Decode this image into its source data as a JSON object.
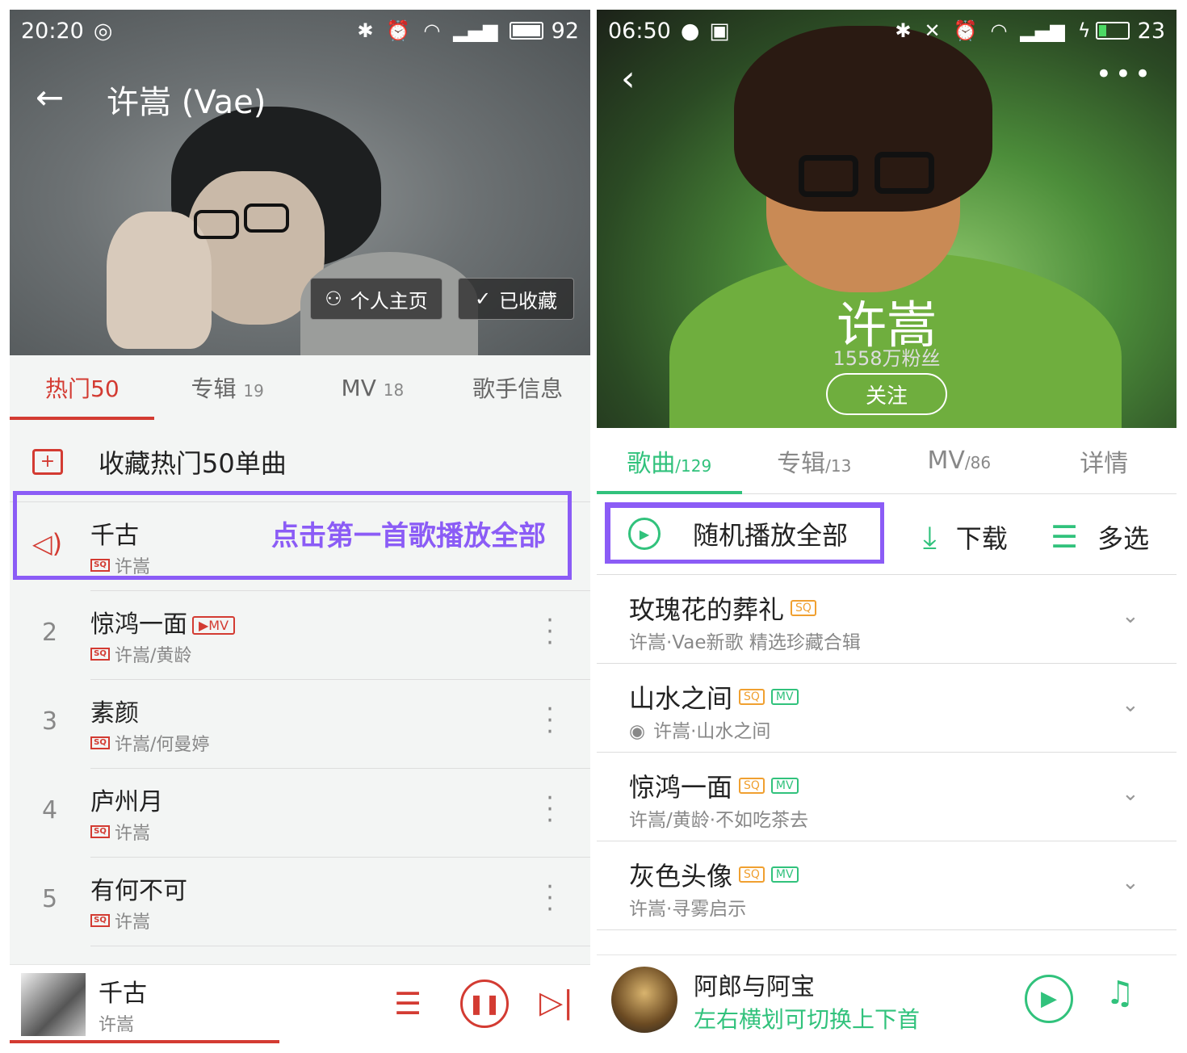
{
  "left": {
    "status": {
      "time": "20:20",
      "battery": "92"
    },
    "title": "许嵩 (Vae)",
    "buttons": {
      "profile": "个人主页",
      "collected": "已收藏"
    },
    "tabs": [
      {
        "label": "热门50",
        "count": ""
      },
      {
        "label": "专辑",
        "count": "19"
      },
      {
        "label": "MV",
        "count": "18"
      },
      {
        "label": "歌手信息",
        "count": ""
      }
    ],
    "collect_label": "收藏热门50单曲",
    "hint": "点击第一首歌播放全部",
    "songs": [
      {
        "num": "",
        "name": "千古",
        "artist": "许嵩",
        "mv": ""
      },
      {
        "num": "2",
        "name": "惊鸿一面",
        "artist": "许嵩/黄龄",
        "mv": "▶MV"
      },
      {
        "num": "3",
        "name": "素颜",
        "artist": "许嵩/何曼婷",
        "mv": ""
      },
      {
        "num": "4",
        "name": "庐州月",
        "artist": "许嵩",
        "mv": ""
      },
      {
        "num": "5",
        "name": "有何不可",
        "artist": "许嵩",
        "mv": ""
      }
    ],
    "sq_label": "SQ",
    "player": {
      "title": "千古",
      "artist": "许嵩"
    }
  },
  "right": {
    "status": {
      "time": "06:50",
      "battery": "23"
    },
    "artist": "许嵩",
    "fans": "1558万粉丝",
    "follow": "关注",
    "tabs": [
      {
        "label": "歌曲",
        "count": "/129"
      },
      {
        "label": "专辑",
        "count": "/13"
      },
      {
        "label": "MV",
        "count": "/86"
      },
      {
        "label": "详情",
        "count": ""
      }
    ],
    "actions": {
      "shuffle": "随机播放全部",
      "download": "下载",
      "multi": "多选"
    },
    "songs": [
      {
        "name": "玫瑰花的葬礼",
        "sub": "许嵩·Vae新歌 精选珍藏合辑",
        "sq": "SQ",
        "mv": ""
      },
      {
        "name": "山水之间",
        "sub": "许嵩·山水之间",
        "sq": "SQ",
        "mv": "MV"
      },
      {
        "name": "惊鸿一面",
        "sub": "许嵩/黄龄·不如吃茶去",
        "sq": "SQ",
        "mv": "MV"
      },
      {
        "name": "灰色头像",
        "sub": "许嵩·寻雾启示",
        "sq": "SQ",
        "mv": "MV"
      }
    ],
    "player": {
      "title": "阿郎与阿宝",
      "hint": "左右横划可切换上下首"
    }
  },
  "colors": {
    "netease_red": "#d33b32",
    "qq_green": "#31c27c",
    "highlight": "#8b5cf6"
  }
}
